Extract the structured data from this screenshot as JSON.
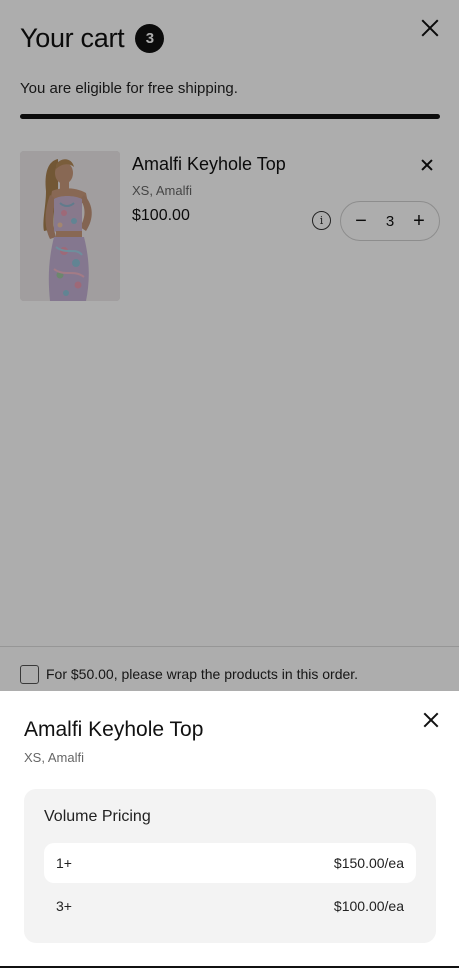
{
  "cart": {
    "title": "Your cart",
    "count": "3",
    "shipping_message": "You are eligible for free shipping.",
    "shipping_progress": 1.0,
    "item": {
      "name": "Amalfi Keyhole Top",
      "variant": "XS, Amalfi",
      "price": "$100.00",
      "quantity": "3",
      "minus_label": "−",
      "plus_label": "+"
    },
    "gift_wrap": {
      "label": "For $50.00, please wrap the products in this order.",
      "checked": false
    }
  },
  "sheet": {
    "title": "Amalfi Keyhole Top",
    "variant": "XS, Amalfi",
    "volume_pricing": {
      "heading": "Volume Pricing",
      "tiers": [
        {
          "qty": "1+",
          "price": "$150.00/ea"
        },
        {
          "qty": "3+",
          "price": "$100.00/ea"
        }
      ]
    }
  },
  "icons": {
    "close": "close-icon",
    "remove": "remove-icon",
    "info": "info-icon"
  },
  "colors": {
    "accent": "#111111",
    "overlay": "rgba(0,0,0,0.32)",
    "card": "#f3f3f3"
  }
}
